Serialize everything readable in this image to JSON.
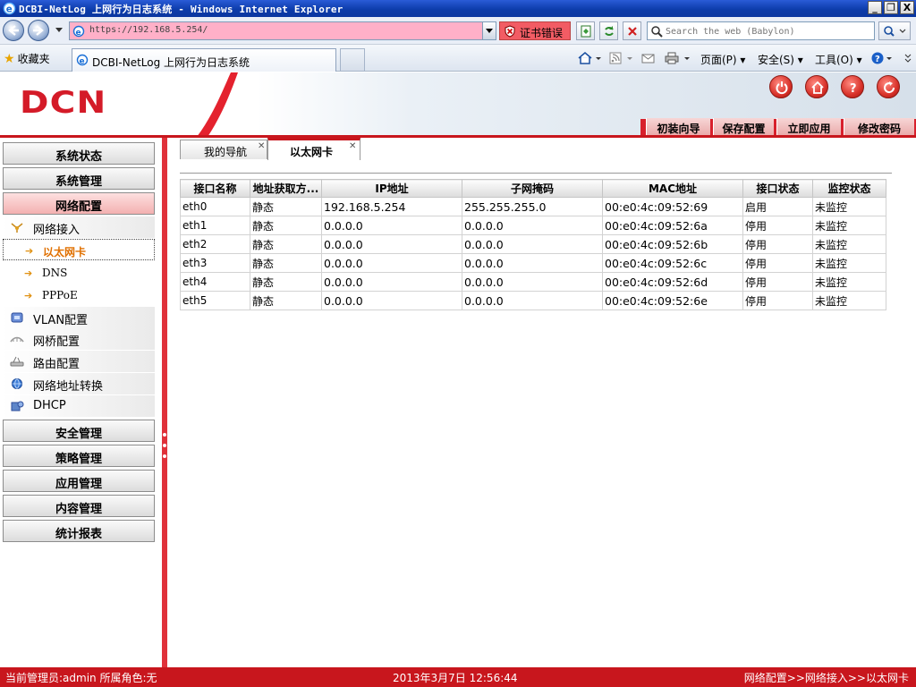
{
  "window": {
    "title": "DCBI-NetLog 上网行为日志系统 - Windows Internet Explorer",
    "min": "_",
    "max": "❐",
    "close": "X"
  },
  "browser": {
    "url": "https://192.168.5.254/",
    "cert_error": "证书错误",
    "search_placeholder": "Search the web (Babylon)",
    "favorites": "收藏夹",
    "tab_title": "DCBI-NetLog 上网行为日志系统",
    "menu_page": "页面(P)",
    "menu_safety": "安全(S)",
    "menu_tools": "工具(O)"
  },
  "app": {
    "logo": "DCN",
    "header_buttons": [
      "初装向导",
      "保存配置",
      "立即应用",
      "修改密码"
    ]
  },
  "sidebar": {
    "sections_top": [
      "系统状态",
      "系统管理",
      "网络配置"
    ],
    "network_sub": {
      "access": "网络接入",
      "leaves": [
        "以太网卡",
        "DNS",
        "PPPoE"
      ],
      "others": [
        "VLAN配置",
        "网桥配置",
        "路由配置",
        "网络地址转换",
        "DHCP"
      ]
    },
    "sections_bottom": [
      "安全管理",
      "策略管理",
      "应用管理",
      "内容管理",
      "统计报表"
    ]
  },
  "content": {
    "tabs": [
      "我的导航",
      "以太网卡"
    ],
    "columns": [
      "接口名称",
      "地址获取方...",
      "IP地址",
      "子网掩码",
      "MAC地址",
      "接口状态",
      "监控状态"
    ],
    "rows": [
      [
        "eth0",
        "静态",
        "192.168.5.254",
        "255.255.255.0",
        "00:e0:4c:09:52:69",
        "启用",
        "未监控"
      ],
      [
        "eth1",
        "静态",
        "0.0.0.0",
        "0.0.0.0",
        "00:e0:4c:09:52:6a",
        "停用",
        "未监控"
      ],
      [
        "eth2",
        "静态",
        "0.0.0.0",
        "0.0.0.0",
        "00:e0:4c:09:52:6b",
        "停用",
        "未监控"
      ],
      [
        "eth3",
        "静态",
        "0.0.0.0",
        "0.0.0.0",
        "00:e0:4c:09:52:6c",
        "停用",
        "未监控"
      ],
      [
        "eth4",
        "静态",
        "0.0.0.0",
        "0.0.0.0",
        "00:e0:4c:09:52:6d",
        "停用",
        "未监控"
      ],
      [
        "eth5",
        "静态",
        "0.0.0.0",
        "0.0.0.0",
        "00:e0:4c:09:52:6e",
        "停用",
        "未监控"
      ]
    ]
  },
  "status": {
    "user": "当前管理员:admin  所属角色:无",
    "datetime": "2013年3月7日 12:56:44",
    "breadcrumb": "网络配置>>网络接入>>以太网卡"
  },
  "colors": {
    "brand_red": "#c8161d",
    "cert_error": "#f25c64",
    "address_bg": "#ffb0c8",
    "selected_leaf": "#e07000"
  }
}
